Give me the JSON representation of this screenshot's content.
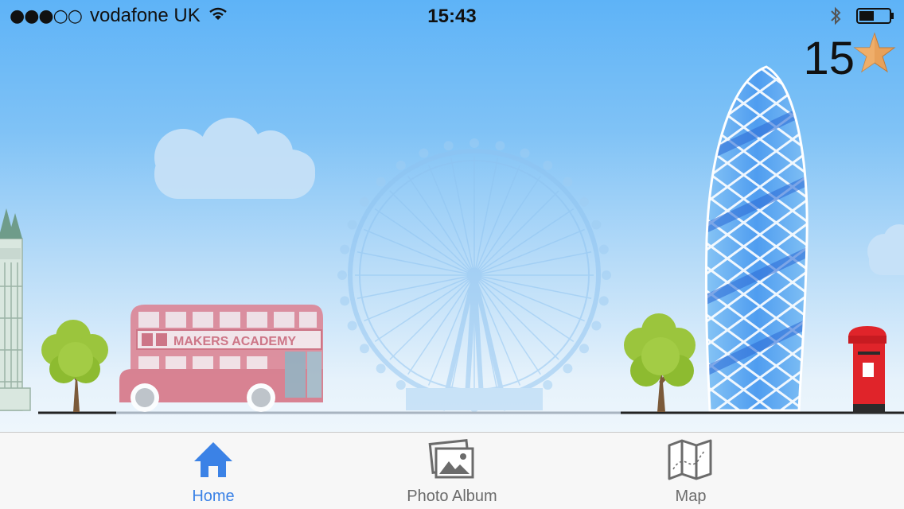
{
  "status_bar": {
    "signal": "●●●○○",
    "carrier": "vodafone UK",
    "time": "15:43"
  },
  "game": {
    "score": "15",
    "bus_sign": "MAKERS ACADEMY"
  },
  "tabs": [
    {
      "label": "Home",
      "icon": "home-icon",
      "active": true
    },
    {
      "label": "Photo Album",
      "icon": "photo-album-icon",
      "active": false
    },
    {
      "label": "Map",
      "icon": "map-icon",
      "active": false
    }
  ],
  "colors": {
    "accent": "#3b82e6",
    "inactive": "#6b6b6b",
    "sky_top": "#5eb3f7",
    "bus": "#d9707c",
    "postbox": "#e0242a",
    "tree": "#9bc53d"
  }
}
